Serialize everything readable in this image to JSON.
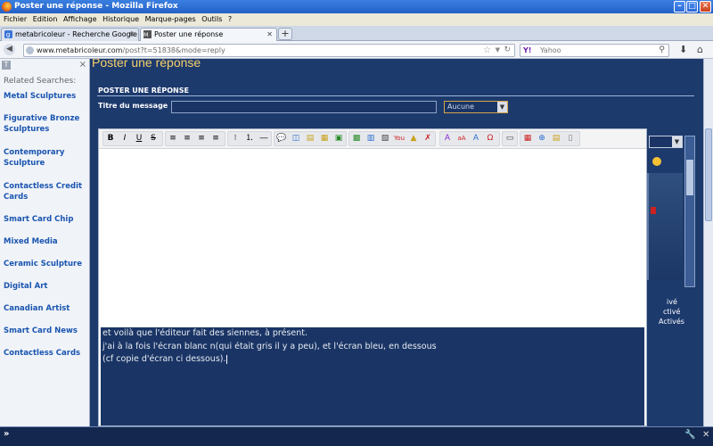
{
  "window": {
    "title": "Poster une réponse - Mozilla Firefox"
  },
  "menu": [
    "Fichier",
    "Edition",
    "Affichage",
    "Historique",
    "Marque-pages",
    "Outils",
    "?"
  ],
  "tabs": [
    {
      "label": "metabricoleur - Recherche Google",
      "active": false
    },
    {
      "label": "Poster une réponse",
      "active": true
    }
  ],
  "nav": {
    "url_host": "www.metabricoleur.com",
    "url_path": "/post?t=51838&mode=reply",
    "search_engine": "Y!",
    "search_placeholder": "Yahoo"
  },
  "sidebar": {
    "heading": "Related Searches:",
    "items": [
      "Metal Sculptures",
      "Figurative Bronze Sculptures",
      "Contemporary Sculpture",
      "Contactless Credit Cards",
      "Smart Card Chip",
      "Mixed Media",
      "Ceramic Sculpture",
      "Digital Art",
      "Canadian Artist",
      "Smart Card News",
      "Contactless Cards"
    ]
  },
  "page": {
    "heading": "Poster une réponse",
    "section_title": "POSTER UNE RÉPONSE",
    "subject_label": "Titre du message",
    "subject_value": "",
    "icon_select_value": "Aucune",
    "editor_lines": [
      "et voilà que l'éditeur fait des siennes, à présent.",
      "j'ai à la fois l'écran blanc n(qui était gris il y a peu), et l'écran bleu, en dessous",
      "(cf copie d'écran ci dessous)."
    ],
    "right_options": [
      "ivé",
      "ctivé",
      "Activés"
    ]
  },
  "colors": {
    "page_bg": "#1d3a6d",
    "heading": "#f5d06a",
    "link": "#1a55b0"
  }
}
